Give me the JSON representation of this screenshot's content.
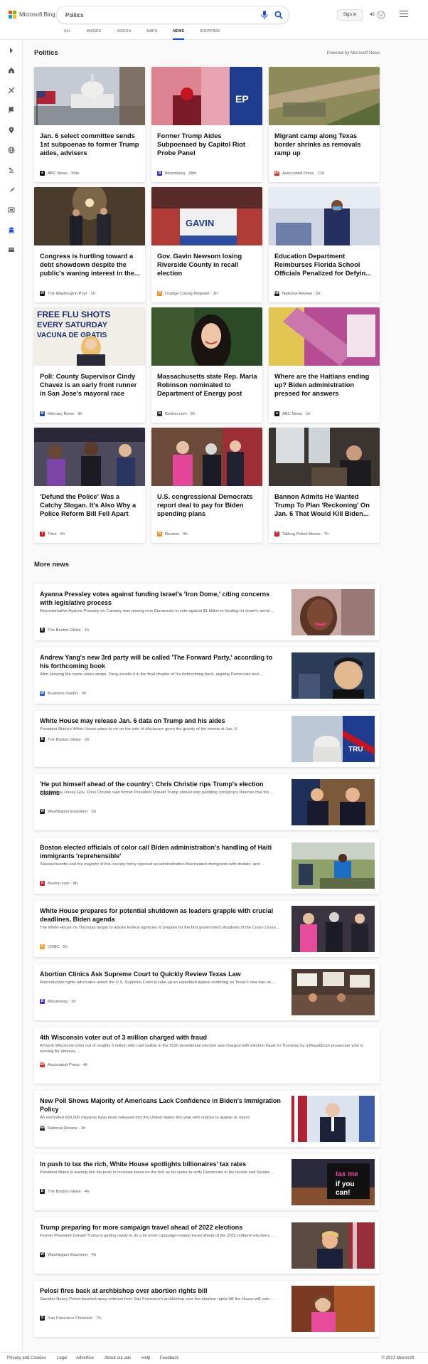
{
  "header": {
    "logo_text": "Microsoft Bing",
    "search_value": "Politics",
    "signin_label": "Sign in",
    "rewards_count": "40",
    "tabs": [
      {
        "label": "ALL"
      },
      {
        "label": "IMAGES"
      },
      {
        "label": "VIDEOS"
      },
      {
        "label": "MAPS"
      },
      {
        "label": "NEWS"
      },
      {
        "label": "SHOPPING"
      }
    ],
    "active_tab": "NEWS"
  },
  "rail_icons": [
    "expand-icon",
    "home-icon",
    "sports-icon",
    "flag-icon",
    "location-icon",
    "globe-icon",
    "money-icon",
    "science-icon",
    "entertainment-icon",
    "politics-icon",
    "more-icon"
  ],
  "section": {
    "title": "Politics",
    "powered_by": "Powered by Microsoft News"
  },
  "cards": [
    {
      "title": "Jan. 6 select committee sends 1st subpoenas to former Trump aides, advisers",
      "source": "ABC News",
      "time": "59m",
      "logo_color": "#111111"
    },
    {
      "title": "Former Trump Aides Subpoenaed by Capitol Riot Probe Panel",
      "source": "Bloomberg",
      "time": "28m",
      "logo_color": "#472cd4"
    },
    {
      "title": "Migrant camp along Texas border shrinks as removals ramp up",
      "source": "Associated Press",
      "time": "11h",
      "logo_color": "#e03027"
    },
    {
      "title": "Congress is hurtling toward a debt showdown despite the public's waning interest in the...",
      "source": "The Washington Post",
      "time": "1h",
      "logo_color": "#111111"
    },
    {
      "title": "Gov. Gavin Newsom losing Riverside County in recall election",
      "source": "Orange County Register",
      "time": "1h",
      "logo_color": "#f08c1c"
    },
    {
      "title": "Education Department Reimburses Florida School Officials Penalized for Defyin...",
      "source": "National Review",
      "time": "2h",
      "logo_color": "#222222"
    },
    {
      "title": "Poll: County Supervisor Cindy Chavez is an early front runner in San Jose's mayoral race",
      "source": "Mercury News",
      "time": "3h",
      "logo_color": "#1a4aa8"
    },
    {
      "title": "Massachusetts state Rep. Maria Robinson nominated to Department of Energy post",
      "source": "Boston.com",
      "time": "5h",
      "logo_color": "#333333"
    },
    {
      "title": "Where are the Haitians ending up? Biden administration pressed for answers",
      "source": "ABC News",
      "time": "1h",
      "logo_color": "#111111"
    },
    {
      "title": "'Defund the Police' Was a Catchy Slogan. It's Also Why a Police Reform Bill Fell Apart",
      "source": "Time",
      "time": "6h",
      "logo_color": "#e21a1a"
    },
    {
      "title": "U.S. congressional Democrats report deal to pay for Biden spending plans",
      "source": "Reuters",
      "time": "9h",
      "logo_color": "#f08c1c"
    },
    {
      "title": "Bannon Admits He Wanted Trump To Plan 'Reckoning' On Jan. 6 That Would Kill Biden...",
      "source": "Talking Points Memo",
      "time": "7h",
      "logo_color": "#d21e2b"
    }
  ],
  "more_news": {
    "title": "More news",
    "items": [
      {
        "title": "Ayanna Pressley votes against funding Israel's 'Iron Dome,' citing concerns with legislative process",
        "snippet": "Representative Ayanna Pressley on Tuesday was among nine Democrats to vote against $1 billion in funding for Israel's aerial ...",
        "source": "The Boston Globe",
        "time": "1h",
        "logo_color": "#222222"
      },
      {
        "title": "Andrew Yang's new 3rd party will be called 'The Forward Party,' according to his forthcoming book",
        "snippet": "After keeping the name under wraps, Yang unveils it in the final chapter of his forthcoming book, arguing Democrats and ...",
        "source": "Business Insider",
        "time": "3h",
        "logo_color": "#1a5fd8"
      },
      {
        "title": "White House may release Jan. 6 data on Trump and his aides",
        "snippet": "President Biden's White House plans to err on the side of disclosure given the gravity of the events of Jan. 6.",
        "source": "The Boston Globe",
        "time": "3h",
        "logo_color": "#222222"
      },
      {
        "title": "'He put himself ahead of the country': Chris Christie rips Trump's election claims",
        "snippet": "Former New Jersey Gov. Chris Christie said former President Donald Trump should stop peddling conspiracy theories that the ...",
        "source": "Washington Examiner",
        "time": "5h",
        "logo_color": "#222222"
      },
      {
        "title": "Boston elected officials of color call Biden administration's handling of Haiti immigrants 'reprehensible'",
        "snippet": "'Massachusetts and the majority of this country firmly rejected an administration that treated immigrants with disdain, and ...",
        "source": "Boston.com",
        "time": "8h",
        "logo_color": "#d21e2b"
      },
      {
        "title": "White House prepares for potential shutdown as leaders grapple with crucial deadlines, Biden agenda",
        "snippet": "The White House on Thursday began to advise federal agencies to prepare for the first government shutdown of the Covid-19 era ...",
        "source": "CNBC",
        "time": "5h",
        "logo_color": "#f0a21c"
      },
      {
        "title": "Abortion Clinics Ask Supreme Court to Quickly Review Texas Law",
        "snippet": "Reproductive-rights advocates asked the U.S. Supreme Court to take up an expedited appeal centering on Texas's new ban on ...",
        "source": "Bloomberg",
        "time": "2h",
        "logo_color": "#472cd4"
      },
      {
        "title": "4th Wisconsin voter out of 3 million charged with fraud",
        "snippet": "A fourth Wisconsin voter out of roughly 3 million who cast ballots in the 2020 presidential election was charged with election fraud on Thursday by a Republican prosecutor who is running for attorney ...",
        "source": "Associated Press",
        "time": "4h",
        "logo_color": "#e03027"
      },
      {
        "title": "New Poll Shows Majority of Americans Lack Confidence in Biden's Immigration Policy",
        "snippet": "An estimated 600,000 migrants have been released into the United States this year with notices to appear or report.",
        "source": "National Review",
        "time": "3h",
        "logo_color": "#222222"
      },
      {
        "title": "In push to tax the rich, White House spotlights billionaires' tax rates",
        "snippet": "President Biden is leaning into his push to increase taxes on the rich as he seeks to unify Democrats in the House and Senate ...",
        "source": "The Boston Globe",
        "time": "4h",
        "logo_color": "#222222"
      },
      {
        "title": "Trump preparing for more campaign travel ahead of 2022 elections",
        "snippet": "Former President Donald Trump is getting ready to do a lot more campaign-related travel ahead of the 2022 midterm elections, ...",
        "source": "Washington Examiner",
        "time": "4h",
        "logo_color": "#222222"
      },
      {
        "title": "Pelosi fires back at archbishop over abortion rights bill",
        "snippet": "Speaker Nancy Pelosi brushed away criticism from San Francisco's archbishop over the abortion rights bill the House will vote ...",
        "source": "San Francisco Chronicle",
        "time": "7h",
        "logo_color": "#222222"
      }
    ]
  },
  "footer": {
    "links": [
      "Privacy and Cookies",
      "Legal",
      "Advertise",
      "About our ads",
      "Help",
      "Feedback"
    ],
    "copyright": "© 2021 Microsoft"
  }
}
